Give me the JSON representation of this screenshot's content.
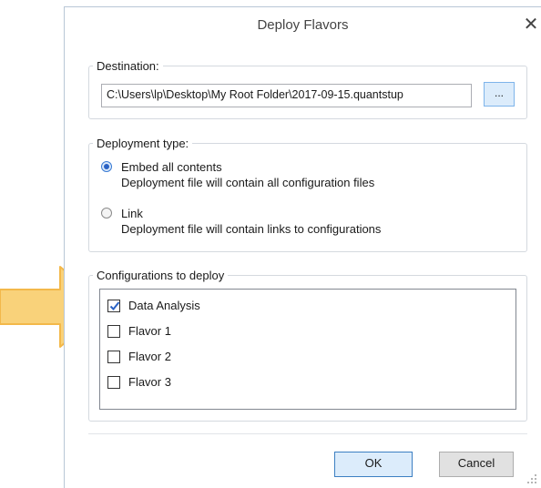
{
  "dialog": {
    "title": "Deploy Flavors",
    "close_glyph": "✕"
  },
  "destination": {
    "legend": "Destination:",
    "path_value": "C:\\Users\\lp\\Desktop\\My Root Folder\\2017-09-15.quantstup",
    "browse_label": "..."
  },
  "deployment_type": {
    "legend": "Deployment type:",
    "options": [
      {
        "label": "Embed all contents",
        "description": "Deployment file will contain all configuration files",
        "selected": true
      },
      {
        "label": "Link",
        "description": "Deployment file will contain links to configurations",
        "selected": false
      }
    ]
  },
  "configurations": {
    "legend": "Configurations to deploy",
    "items": [
      {
        "label": "Data Analysis",
        "checked": true
      },
      {
        "label": "Flavor 1",
        "checked": false
      },
      {
        "label": "Flavor 2",
        "checked": false
      },
      {
        "label": "Flavor 3",
        "checked": false
      }
    ]
  },
  "buttons": {
    "ok_label": "OK",
    "cancel_label": "Cancel"
  },
  "colors": {
    "arrow_fill": "#f9d27a",
    "arrow_stroke": "#f3b84a",
    "accent": "#2a62c4"
  },
  "icons": {
    "close": "close-icon",
    "check": "checkmark-icon",
    "grip": "resize-grip-icon",
    "arrow": "arrow-pointer"
  }
}
